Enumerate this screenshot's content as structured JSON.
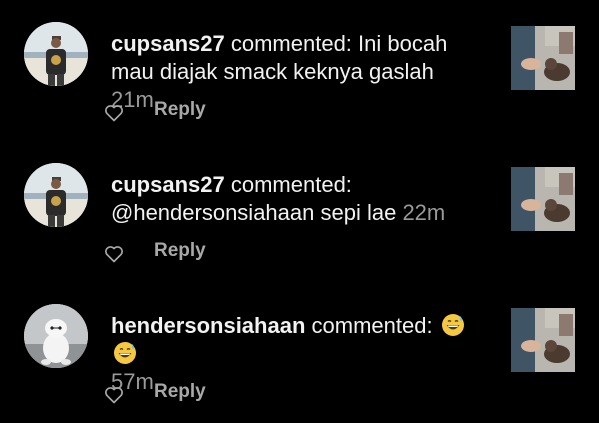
{
  "notifications": [
    {
      "username": "cupsans27",
      "action": "commented:",
      "line1": "Ini bocah",
      "line2": "mau diajak smack keknya gaslah",
      "time": "21m",
      "reply_label": "Reply",
      "avatar": "man-beach-avatar",
      "thumbnail": "cat-photo-thumbnail"
    },
    {
      "username": "cupsans27",
      "action": "commented:",
      "line1": "",
      "line2": "@hendersonsiahaan sepi lae",
      "time": "22m",
      "reply_label": "Reply",
      "avatar": "man-beach-avatar",
      "thumbnail": "cat-photo-thumbnail"
    },
    {
      "username": "hendersonsiahaan",
      "action": "commented:",
      "emojis": [
        "grinning-sweat-emoji",
        "grinning-sweat-emoji"
      ],
      "time": "57m",
      "reply_label": "Reply",
      "avatar": "white-robot-avatar",
      "thumbnail": "cat-photo-thumbnail"
    }
  ],
  "colors": {
    "background": "#000000",
    "text": "#f2f2f2",
    "muted": "#9a9a9a",
    "reply": "#a8a8a8",
    "emoji": "#f5c842"
  }
}
